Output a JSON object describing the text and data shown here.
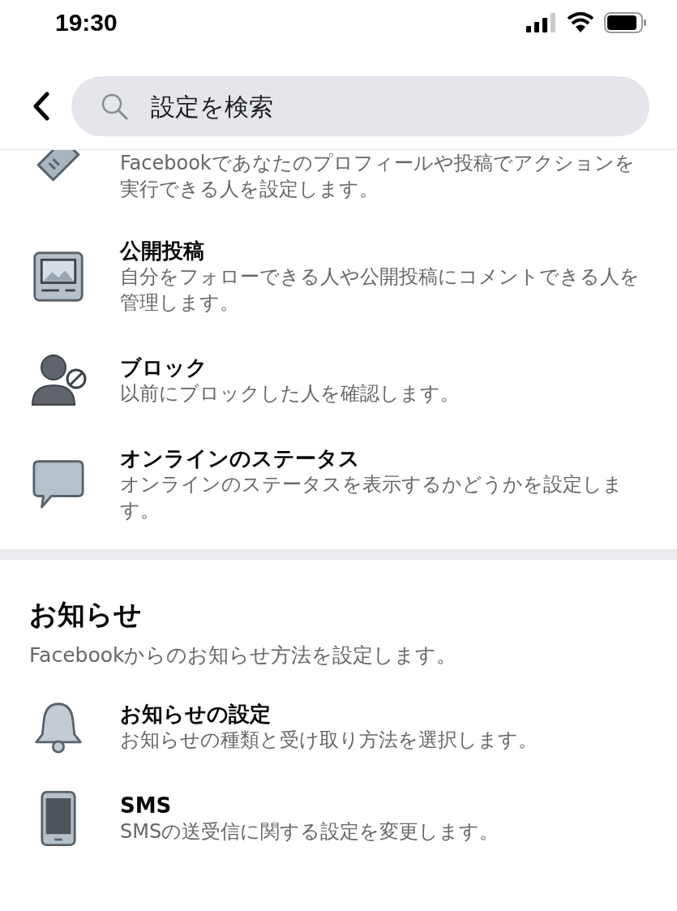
{
  "status_bar": {
    "time": "19:30"
  },
  "search": {
    "placeholder": "設定を検索"
  },
  "sections": [
    {
      "items": [
        {
          "description": "Facebookであなたのプロフィールや投稿でアクションを実行できる人を設定します。"
        },
        {
          "title": "公開投稿",
          "description": "自分をフォローできる人や公開投稿にコメントできる人を管理します。"
        },
        {
          "title": "ブロック",
          "description": "以前にブロックした人を確認します。"
        },
        {
          "title": "オンラインのステータス",
          "description": "オンラインのステータスを表示するかどうかを設定します。"
        }
      ]
    },
    {
      "title": "お知らせ",
      "description": "Facebookからのお知らせ方法を設定します。",
      "items": [
        {
          "title": "お知らせの設定",
          "description": "お知らせの種類と受け取り方法を選択します。"
        },
        {
          "title": "SMS",
          "description": "SMSの送受信に関する設定を変更します。"
        }
      ]
    }
  ]
}
